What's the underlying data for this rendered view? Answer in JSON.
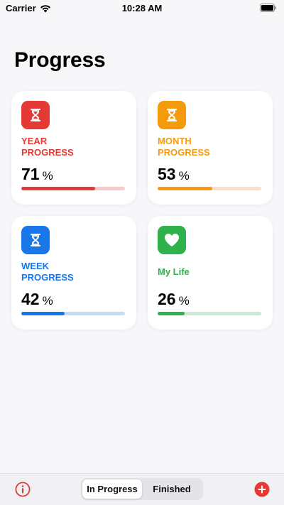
{
  "status_bar": {
    "carrier": "Carrier",
    "time": "10:28 AM"
  },
  "page": {
    "title": "Progress"
  },
  "cards": [
    {
      "label": "YEAR\nPROGRESS",
      "value": "71",
      "unit": "%",
      "progress": 0.71,
      "color": "#e53935",
      "track": "#f4cccc",
      "icon": "hourglass-icon"
    },
    {
      "label": "MONTH\nPROGRESS",
      "value": "53",
      "unit": "%",
      "progress": 0.53,
      "color": "#f59a0b",
      "track": "#f7e1c6",
      "icon": "hourglass-icon"
    },
    {
      "label": "WEEK\nPROGRESS",
      "value": "42",
      "unit": "%",
      "progress": 0.42,
      "color": "#1877e8",
      "track": "#c6dcf5",
      "icon": "hourglass-icon"
    },
    {
      "label": "My Life",
      "value": "26",
      "unit": "%",
      "progress": 0.26,
      "color": "#2fb24c",
      "track": "#cde9d3",
      "icon": "heart-icon"
    }
  ],
  "tab_bar": {
    "segments": [
      "In Progress",
      "Finished"
    ],
    "selected": "In Progress",
    "accent": "#e53935"
  }
}
